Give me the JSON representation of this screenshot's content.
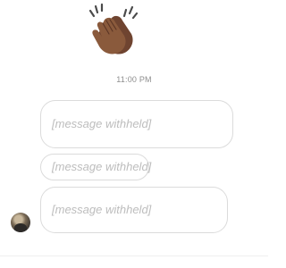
{
  "chat": {
    "reaction_emoji": "clapping-hands-emoji",
    "timestamp": "11:00 PM",
    "messages": [
      {
        "text": "[message withheld]"
      },
      {
        "text": "[message withheld]"
      },
      {
        "text": "[message withheld]"
      }
    ]
  },
  "colors": {
    "bubble_border": "#dbdbdb",
    "timestamp_text": "#8e8e8e",
    "emoji_skin": "#8a5a3c"
  }
}
